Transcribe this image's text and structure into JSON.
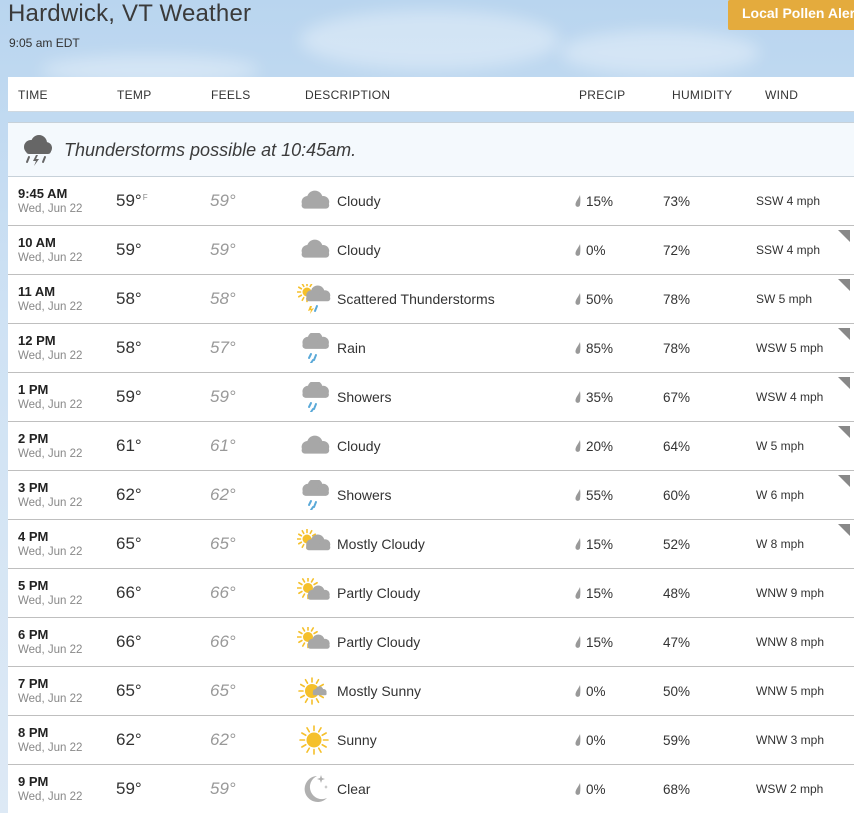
{
  "header": {
    "title": "Hardwick, VT Weather",
    "time": "9:05 am EDT",
    "pollen_button": "Local Pollen Alert"
  },
  "columns": {
    "time": "TIME",
    "temp": "TEMP",
    "feels": "FEELS",
    "description": "DESCRIPTION",
    "precip": "PRECIP",
    "humidity": "HUMIDITY",
    "wind": "WIND"
  },
  "alert": {
    "text": "Thunderstorms possible at 10:45am.",
    "icon": "thunderstorm-cloud-icon"
  },
  "temp_unit": "F",
  "colors": {
    "pollen": "#e4ab3d",
    "sun": "#f5c02b",
    "cloud": "#a7a7a7",
    "rain": "#5aa9d8"
  },
  "rows": [
    {
      "time": "9:45 AM",
      "date": "Wed, Jun 22",
      "temp": "59°",
      "feels": "59°",
      "icon": "cloudy",
      "desc": "Cloudy",
      "precip": "15%",
      "humidity": "73%",
      "wind": "SSW 4 mph",
      "expand": false,
      "unit": true
    },
    {
      "time": "10 AM",
      "date": "Wed, Jun 22",
      "temp": "59°",
      "feels": "59°",
      "icon": "cloudy",
      "desc": "Cloudy",
      "precip": "0%",
      "humidity": "72%",
      "wind": "SSW 4 mph",
      "expand": true
    },
    {
      "time": "11 AM",
      "date": "Wed, Jun 22",
      "temp": "58°",
      "feels": "58°",
      "icon": "scattered-thunderstorms",
      "desc": "Scattered Thunderstorms",
      "precip": "50%",
      "humidity": "78%",
      "wind": "SW 5 mph",
      "expand": true
    },
    {
      "time": "12 PM",
      "date": "Wed, Jun 22",
      "temp": "58°",
      "feels": "57°",
      "icon": "rain",
      "desc": "Rain",
      "precip": "85%",
      "humidity": "78%",
      "wind": "WSW 5 mph",
      "expand": true
    },
    {
      "time": "1 PM",
      "date": "Wed, Jun 22",
      "temp": "59°",
      "feels": "59°",
      "icon": "showers",
      "desc": "Showers",
      "precip": "35%",
      "humidity": "67%",
      "wind": "WSW 4 mph",
      "expand": true
    },
    {
      "time": "2 PM",
      "date": "Wed, Jun 22",
      "temp": "61°",
      "feels": "61°",
      "icon": "cloudy",
      "desc": "Cloudy",
      "precip": "20%",
      "humidity": "64%",
      "wind": "W 5 mph",
      "expand": true
    },
    {
      "time": "3 PM",
      "date": "Wed, Jun 22",
      "temp": "62°",
      "feels": "62°",
      "icon": "showers",
      "desc": "Showers",
      "precip": "55%",
      "humidity": "60%",
      "wind": "W 6 mph",
      "expand": true
    },
    {
      "time": "4 PM",
      "date": "Wed, Jun 22",
      "temp": "65°",
      "feels": "65°",
      "icon": "mostly-cloudy",
      "desc": "Mostly Cloudy",
      "precip": "15%",
      "humidity": "52%",
      "wind": "W 8 mph",
      "expand": true
    },
    {
      "time": "5 PM",
      "date": "Wed, Jun 22",
      "temp": "66°",
      "feels": "66°",
      "icon": "partly-cloudy",
      "desc": "Partly Cloudy",
      "precip": "15%",
      "humidity": "48%",
      "wind": "WNW 9 mph",
      "expand": false
    },
    {
      "time": "6 PM",
      "date": "Wed, Jun 22",
      "temp": "66°",
      "feels": "66°",
      "icon": "partly-cloudy",
      "desc": "Partly Cloudy",
      "precip": "15%",
      "humidity": "47%",
      "wind": "WNW 8 mph",
      "expand": false
    },
    {
      "time": "7 PM",
      "date": "Wed, Jun 22",
      "temp": "65°",
      "feels": "65°",
      "icon": "mostly-sunny",
      "desc": "Mostly Sunny",
      "precip": "0%",
      "humidity": "50%",
      "wind": "WNW 5 mph",
      "expand": false
    },
    {
      "time": "8 PM",
      "date": "Wed, Jun 22",
      "temp": "62°",
      "feels": "62°",
      "icon": "sunny",
      "desc": "Sunny",
      "precip": "0%",
      "humidity": "59%",
      "wind": "WNW 3 mph",
      "expand": false
    },
    {
      "time": "9 PM",
      "date": "Wed, Jun 22",
      "temp": "59°",
      "feels": "59°",
      "icon": "clear-night",
      "desc": "Clear",
      "precip": "0%",
      "humidity": "68%",
      "wind": "WSW 2 mph",
      "expand": false
    }
  ]
}
